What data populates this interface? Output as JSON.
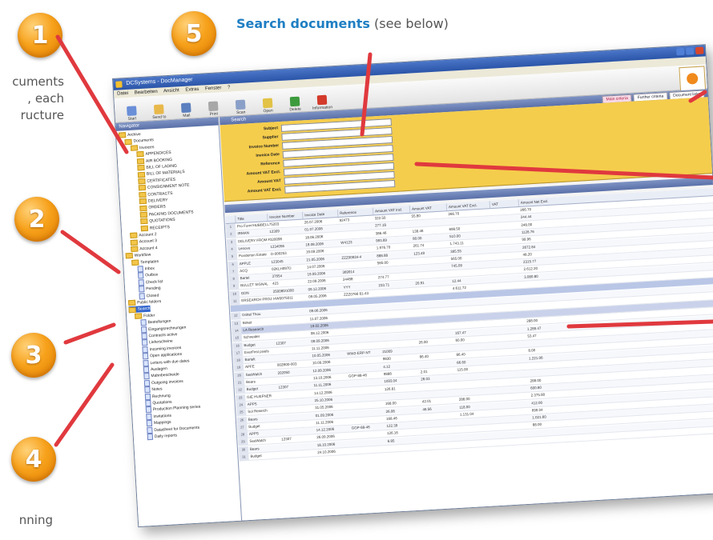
{
  "headline": {
    "strong": "Search documents",
    "rest": " (see below)"
  },
  "badges": [
    "1",
    "5",
    "2",
    "3",
    "4"
  ],
  "side_notes": {
    "note1": [
      "cuments",
      ", each",
      "ructure"
    ],
    "note4": [
      "nning"
    ]
  },
  "window": {
    "title": "DCSystems - DocManager",
    "menu": [
      "Datei",
      "Bearbeiten",
      "Ansicht",
      "Extras",
      "Fenster",
      "?"
    ],
    "toolbar": [
      "Start",
      "Send to",
      "Mail",
      "Print",
      "Scan",
      "Open",
      "Delete",
      "Information"
    ]
  },
  "left_pane": {
    "title": "Navigator",
    "tree": [
      {
        "label": "Archive",
        "depth": 0,
        "kind": "folder"
      },
      {
        "label": "Documents",
        "depth": 1,
        "kind": "folder"
      },
      {
        "label": "Invoices",
        "depth": 2,
        "kind": "folder"
      },
      {
        "label": "APPENDICES",
        "depth": 3,
        "kind": "folder"
      },
      {
        "label": "AIR BOOKING",
        "depth": 3,
        "kind": "folder"
      },
      {
        "label": "BILL OF LADING",
        "depth": 3,
        "kind": "folder"
      },
      {
        "label": "BILL OF MATERIALS",
        "depth": 3,
        "kind": "folder"
      },
      {
        "label": "CERTIFICATES",
        "depth": 3,
        "kind": "folder"
      },
      {
        "label": "CONSIGNMENT NOTE",
        "depth": 3,
        "kind": "folder"
      },
      {
        "label": "CONTRACTS",
        "depth": 3,
        "kind": "folder"
      },
      {
        "label": "DELIVERY",
        "depth": 3,
        "kind": "folder"
      },
      {
        "label": "ORDERS",
        "depth": 3,
        "kind": "folder"
      },
      {
        "label": "PACKING DOCUMENTS",
        "depth": 3,
        "kind": "folder"
      },
      {
        "label": "QUOTATIONS",
        "depth": 3,
        "kind": "folder"
      },
      {
        "label": "RECEIPTS",
        "depth": 3,
        "kind": "folder"
      },
      {
        "label": "Account 2",
        "depth": 1,
        "kind": "folder"
      },
      {
        "label": "Account 3",
        "depth": 1,
        "kind": "folder"
      },
      {
        "label": "Account 4",
        "depth": 1,
        "kind": "folder"
      },
      {
        "label": "Workflow",
        "depth": 0,
        "kind": "folder"
      },
      {
        "label": "Templates",
        "depth": 1,
        "kind": "folder"
      },
      {
        "label": "Inbox",
        "depth": 2,
        "kind": "doc"
      },
      {
        "label": "Outbox",
        "depth": 2,
        "kind": "doc"
      },
      {
        "label": "Check list",
        "depth": 2,
        "kind": "doc"
      },
      {
        "label": "Pending",
        "depth": 2,
        "kind": "doc"
      },
      {
        "label": "Closed",
        "depth": 2,
        "kind": "doc"
      },
      {
        "label": "Public folders",
        "depth": 0,
        "kind": "folder"
      },
      {
        "label": "Search",
        "depth": 0,
        "kind": "folder",
        "selected": true
      },
      {
        "label": "Folder",
        "depth": 1,
        "kind": "folder"
      },
      {
        "label": "Bestellungen",
        "depth": 2,
        "kind": "doc"
      },
      {
        "label": "Eingangsrechnungen",
        "depth": 2,
        "kind": "doc"
      },
      {
        "label": "Contracts active",
        "depth": 2,
        "kind": "doc"
      },
      {
        "label": "Lieferscheine",
        "depth": 2,
        "kind": "doc"
      },
      {
        "label": "Incoming invoices",
        "depth": 2,
        "kind": "doc"
      },
      {
        "label": "Open applications",
        "depth": 2,
        "kind": "doc"
      },
      {
        "label": "Letters with due dates",
        "depth": 2,
        "kind": "doc"
      },
      {
        "label": "Auslagen",
        "depth": 2,
        "kind": "doc"
      },
      {
        "label": "Mahnbescheide",
        "depth": 2,
        "kind": "doc"
      },
      {
        "label": "Outgoing invoices",
        "depth": 2,
        "kind": "doc"
      },
      {
        "label": "Notes",
        "depth": 2,
        "kind": "doc"
      },
      {
        "label": "Rechnung",
        "depth": 2,
        "kind": "doc"
      },
      {
        "label": "Quotations",
        "depth": 2,
        "kind": "doc"
      },
      {
        "label": "Production Planning series",
        "depth": 2,
        "kind": "doc"
      },
      {
        "label": "Invitations",
        "depth": 2,
        "kind": "doc"
      },
      {
        "label": "Mappings",
        "depth": 2,
        "kind": "doc"
      },
      {
        "label": "Datasheet for Documents",
        "depth": 2,
        "kind": "doc"
      },
      {
        "label": "Daily reports",
        "depth": 2,
        "kind": "doc"
      }
    ]
  },
  "search": {
    "title": "Search",
    "tabs": [
      "Main criteria",
      "Further criteria",
      "Document links"
    ],
    "fields": [
      "Subject",
      "Supplier",
      "Invoice Number",
      "Invoice Date",
      "Reference",
      "Amount VAT Excl.",
      "Amount VAT",
      "Amount VAT Excl."
    ]
  },
  "grid": {
    "columns": [
      "Title",
      "Invoice Number",
      "Invoice Date",
      "Reference",
      "Amount VAT Incl.",
      "Amount VAT",
      "Amount VAT Excl.",
      "VAT",
      "Amount Net Excl."
    ],
    "rows": [
      [
        "Pro Form'HUBBELL PARTS",
        "75203",
        "26.07.2006",
        "92473",
        "322.50",
        "55.80",
        "266.70",
        "",
        "266.70"
      ],
      [
        "IRMAN",
        "12309",
        "01.07.2006",
        "",
        "277.18",
        "",
        "",
        "",
        "244.44"
      ],
      [
        "DELIVERY FROM PRINT",
        "320098",
        "18.06.2006",
        "",
        "386.46",
        "138.46",
        "698.50",
        "",
        "248.00"
      ],
      [
        "Lenovo",
        "1234056",
        "18.08.2006",
        "W4123",
        "993.89",
        "80.00",
        "510.00",
        "",
        "1128.76"
      ],
      [
        "Ponderton Estate",
        "D-000253",
        "19.09.2006",
        "",
        "1.976.70",
        "261.74",
        "1.743.11",
        "",
        "99.96"
      ],
      [
        "APPLE",
        "123045",
        "21.05.2006",
        "ZZZ00934-4",
        "888.88",
        "123.49",
        "395.55",
        "",
        "2672.84"
      ],
      [
        "ACQ",
        "02KLH097D",
        "14.07.2006",
        "",
        "565.00",
        "",
        "565.00",
        "",
        "48.20"
      ],
      [
        "Bartel",
        "37654",
        "19.09.2006",
        "369914",
        "",
        "",
        "745.09",
        "",
        "2315.77"
      ],
      [
        "BULLET SIGNAL",
        "423",
        "22.09.2006",
        "24488",
        "274.77",
        "",
        "",
        "",
        "2.612.20"
      ],
      [
        "GDN",
        "250080/1000",
        "09.12.2006",
        "YYY",
        "233.71",
        "20.91",
        "12.44",
        "",
        "3.080.80"
      ],
      [
        "ERSEARCH PROJ",
        "HW0075011",
        "09.05.2006",
        "ZZZ0766 81-43",
        "",
        "",
        "4.611.72",
        "",
        ""
      ],
      [
        "Drittel Thou",
        "",
        "09.06.2006",
        "",
        "",
        "",
        "",
        "",
        ""
      ],
      [
        "Birket",
        "",
        "11.07.2006",
        "",
        "",
        "",
        "",
        "",
        ""
      ],
      [
        "LA Research",
        "",
        "19.02.2006",
        "",
        "",
        "",
        "",
        "",
        ""
      ],
      [
        "Schneider",
        "",
        "08.12.2006",
        "",
        "",
        "",
        "",
        "",
        "288.00"
      ],
      [
        "Budget",
        "12307",
        "09.09.2006",
        "",
        "",
        "",
        "167.47",
        "",
        "1.289.47"
      ],
      [
        "EverFirst pixels",
        "",
        "11.11.2006",
        "",
        "",
        "26.00",
        "60.00",
        "",
        "53.47"
      ],
      [
        "Bartelt",
        "",
        "10.05.2006",
        "WW2-ERP-NT",
        "21009",
        "",
        "",
        "",
        ""
      ],
      [
        "APFE",
        "002B00-003",
        "10.09.2006",
        "",
        "9830",
        "86.40",
        "86.40",
        "",
        "8.00"
      ],
      [
        "SeaWatch",
        "202050",
        "12.09.2006",
        "",
        "4.12",
        "",
        "66.60",
        "",
        "1.221.06"
      ],
      [
        "Bears",
        "",
        "13.10.2006",
        "GGP-88-46",
        "9888",
        "2.01",
        "115.00",
        "",
        ""
      ],
      [
        "Budget",
        "12307",
        "11.11.2006",
        "",
        "1093.04",
        "28.03",
        "",
        "",
        ""
      ],
      [
        "GIE HUEFNER",
        "",
        "14.12.2006",
        "",
        "126.81",
        "",
        "",
        "",
        "288.00"
      ],
      [
        "APPS",
        "",
        "25.10.2006",
        "",
        "",
        "",
        "",
        "",
        "600.80"
      ],
      [
        "Sol Reserch",
        "",
        "31.05.2006",
        "",
        "168.00",
        "42.01",
        "288.00",
        "",
        "2.375.80"
      ],
      [
        "Bears",
        "",
        "01.09.2006",
        "",
        "26.08",
        "46.56",
        "118.00",
        "",
        "412.00"
      ],
      [
        "Budget",
        "",
        "11.11.2006",
        "",
        "168.46",
        "",
        "1.131.04",
        "",
        "699.04"
      ],
      [
        "APPS",
        "",
        "14.12.2006",
        "GGP-88-46",
        "122.39",
        "",
        "",
        "",
        "1.021.60"
      ],
      [
        "SeaWatch",
        "12307",
        "26.09.2006",
        "",
        "126.16",
        "",
        "",
        "",
        "88.00"
      ],
      [
        "Bears",
        "",
        "18.10.2006",
        "",
        "6.85",
        "",
        "",
        "",
        ""
      ],
      [
        "Budget",
        "",
        "24.10.2006",
        "",
        "",
        "",
        "",
        "",
        ""
      ]
    ]
  },
  "colors": {
    "accent": "#1f7fc3",
    "badge": "#f7a21c",
    "search_panel": "#f5cd4c",
    "leader_line": "#e0393e"
  }
}
